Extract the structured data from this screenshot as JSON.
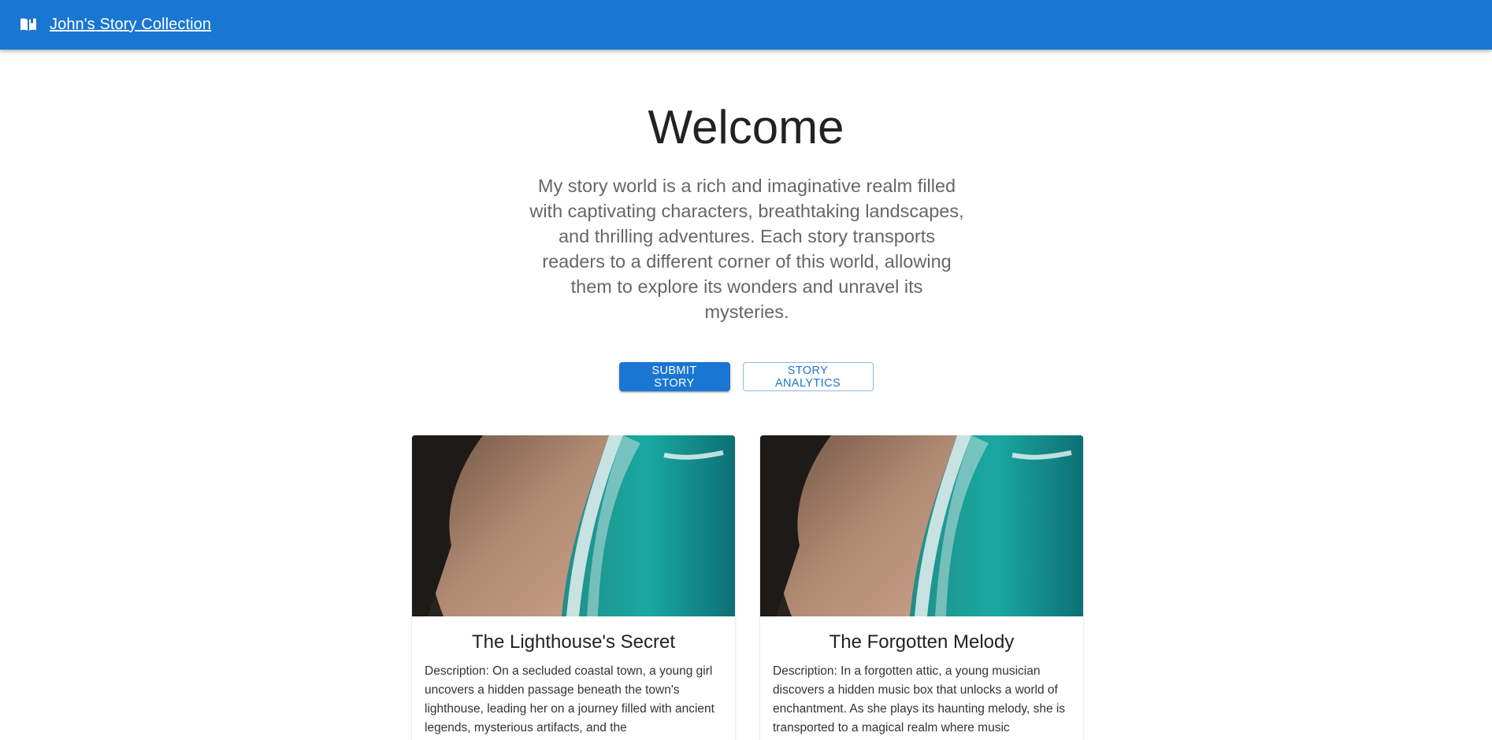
{
  "appbar": {
    "title": "John's Story Collection",
    "icon": "book-icon",
    "color": "#1976d2"
  },
  "hero": {
    "title": "Welcome",
    "description": "My story world is a rich and imaginative realm filled with captivating characters, breathtaking landscapes, and thrilling adventures. Each story transports readers to a different corner of this world, allowing them to explore its wonders and unravel its mysteries."
  },
  "actions": {
    "submit_label": "SUBMIT STORY",
    "analytics_label": "STORY ANALYTICS"
  },
  "stories": [
    {
      "title": "The Lighthouse's Secret",
      "description": "Description: On a secluded coastal town, a young girl uncovers a hidden passage beneath the town's lighthouse, leading her on a journey filled with ancient legends, mysterious artifacts, and the"
    },
    {
      "title": "The Forgotten Melody",
      "description": "Description: In a forgotten attic, a young musician discovers a hidden music box that unlocks a world of enchantment. As she plays its haunting melody, she is transported to a magical realm where music"
    }
  ],
  "colors": {
    "primary": "#1976d2",
    "text_secondary": "#666666"
  }
}
